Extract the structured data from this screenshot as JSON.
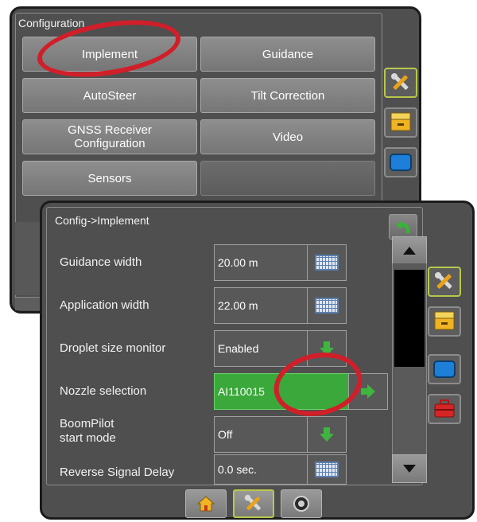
{
  "back_window": {
    "title": "Configuration",
    "buttons": [
      {
        "label": "Implement"
      },
      {
        "label": "Guidance"
      },
      {
        "label": "AutoSteer"
      },
      {
        "label": "Tilt Correction"
      },
      {
        "label": "GNSS Receiver\nConfiguration"
      },
      {
        "label": "Video"
      },
      {
        "label": "Sensors"
      }
    ],
    "side_tabs": [
      {
        "icon": "tools-icon",
        "active": true
      },
      {
        "icon": "drawer-icon",
        "active": false
      },
      {
        "icon": "screen-icon",
        "active": false
      }
    ]
  },
  "front_window": {
    "title": "Config->Implement",
    "rows": [
      {
        "label": "Guidance width",
        "value": "20.00 m",
        "action_icon": "keyboard-icon"
      },
      {
        "label": "Application width",
        "value": "22.00 m",
        "action_icon": "keyboard-icon"
      },
      {
        "label": "Droplet size monitor",
        "value": "Enabled",
        "action_icon": "down-arrow-icon"
      },
      {
        "label": "Nozzle selection",
        "value": "AI110015",
        "action_icon": "right-arrow-icon"
      },
      {
        "label": "BoomPilot\nstart mode",
        "value": "Off",
        "action_icon": "down-arrow-icon"
      },
      {
        "label": "Reverse Signal Delay",
        "value": "0.0 sec.",
        "action_icon": "keyboard-icon"
      }
    ],
    "side_tabs": [
      {
        "icon": "tools-icon",
        "active": true
      },
      {
        "icon": "drawer-icon",
        "active": false
      },
      {
        "icon": "screen-icon",
        "active": false
      },
      {
        "icon": "toolbox-icon",
        "active": false
      }
    ],
    "bottom_nav": [
      {
        "icon": "home-icon",
        "active": false
      },
      {
        "icon": "tools-icon",
        "active": true
      },
      {
        "icon": "camera-icon",
        "active": false
      }
    ]
  },
  "colors": {
    "panel_bg": "#4f4f4f",
    "button_gray": "#7f7f7f",
    "active_green": "#3aa83a",
    "highlight_ring": "#d11f2a",
    "active_tab_border": "#b9c84a"
  }
}
